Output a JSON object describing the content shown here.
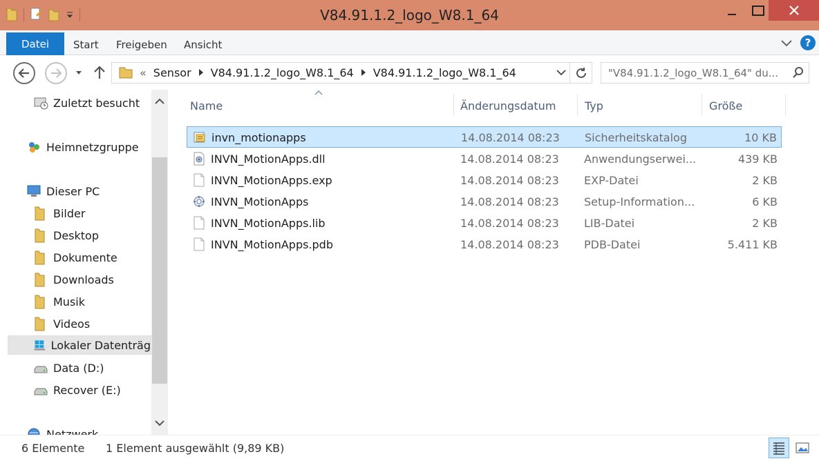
{
  "window": {
    "title": "V84.91.1.2_logo_W8.1_64"
  },
  "ribbon": {
    "file_tab": "Datei",
    "tabs": [
      "Start",
      "Freigeben",
      "Ansicht"
    ],
    "help": "?"
  },
  "address": {
    "prefix": "«",
    "crumbs": [
      "Sensor",
      "V84.91.1.2_logo_W8.1_64",
      "V84.91.1.2_logo_W8.1_64"
    ]
  },
  "search": {
    "placeholder": "\"V84.91.1.2_logo_W8.1_64\" du..."
  },
  "nav": {
    "items": [
      {
        "label": "Zuletzt besucht",
        "icon": "recent-icon"
      },
      {
        "label": "Heimnetzgruppe",
        "icon": "homegroup-icon"
      },
      {
        "label": "Dieser PC",
        "icon": "computer-icon"
      },
      {
        "label": "Bilder",
        "icon": "folder-icon"
      },
      {
        "label": "Desktop",
        "icon": "folder-icon"
      },
      {
        "label": "Dokumente",
        "icon": "folder-icon"
      },
      {
        "label": "Downloads",
        "icon": "folder-icon"
      },
      {
        "label": "Musik",
        "icon": "folder-icon"
      },
      {
        "label": "Videos",
        "icon": "folder-icon"
      },
      {
        "label": "Lokaler Datenträg",
        "icon": "windows-drive-icon"
      },
      {
        "label": "Data (D:)",
        "icon": "drive-icon"
      },
      {
        "label": "Recover (E:)",
        "icon": "drive-icon"
      },
      {
        "label": "Netzwerk",
        "icon": "network-icon"
      }
    ]
  },
  "columns": {
    "name": "Name",
    "date": "Änderungsdatum",
    "type": "Typ",
    "size": "Größe"
  },
  "files": [
    {
      "name": "invn_motionapps",
      "date": "14.08.2014 08:23",
      "type": "Sicherheitskatalog",
      "size": "10 KB",
      "icon": "catalog-icon",
      "selected": true
    },
    {
      "name": "INVN_MotionApps.dll",
      "date": "14.08.2014 08:23",
      "type": "Anwendungserwei...",
      "size": "439 KB",
      "icon": "dll-icon",
      "selected": false
    },
    {
      "name": "INVN_MotionApps.exp",
      "date": "14.08.2014 08:23",
      "type": "EXP-Datei",
      "size": "2 KB",
      "icon": "file-icon",
      "selected": false
    },
    {
      "name": "INVN_MotionApps",
      "date": "14.08.2014 08:23",
      "type": "Setup-Information...",
      "size": "6 KB",
      "icon": "setup-icon",
      "selected": false
    },
    {
      "name": "INVN_MotionApps.lib",
      "date": "14.08.2014 08:23",
      "type": "LIB-Datei",
      "size": "2 KB",
      "icon": "file-icon",
      "selected": false
    },
    {
      "name": "INVN_MotionApps.pdb",
      "date": "14.08.2014 08:23",
      "type": "PDB-Datei",
      "size": "5.411 KB",
      "icon": "file-icon",
      "selected": false
    }
  ],
  "status": {
    "count": "6 Elemente",
    "selection": "1 Element ausgewählt (9,89 KB)"
  },
  "colors": {
    "accent": "#1979ca",
    "titlebar": "#d98a6c",
    "close": "#c7504b",
    "selection": "#cce8ff"
  }
}
